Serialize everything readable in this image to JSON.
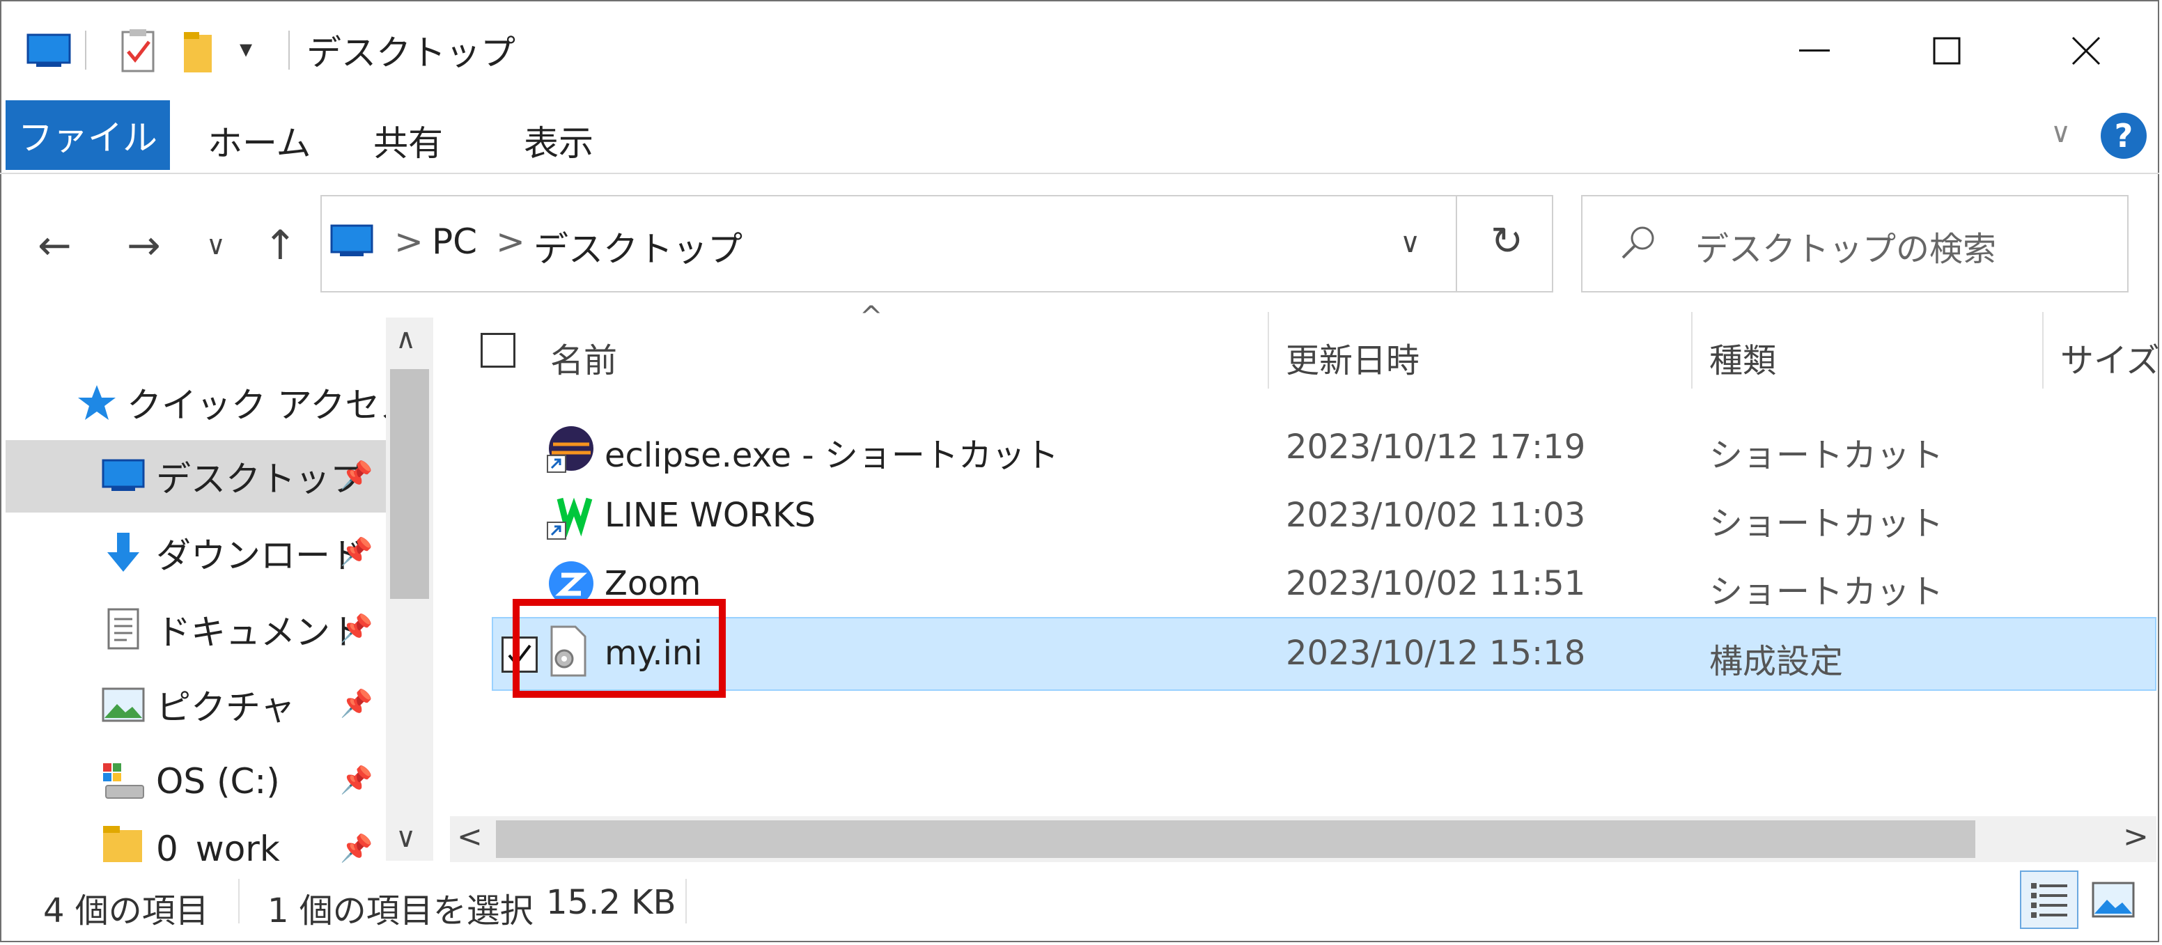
{
  "window": {
    "title": "デスクトップ",
    "minimize_glyph": "—",
    "maximize_glyph": "☐",
    "close_glyph": "✕"
  },
  "ribbon": {
    "tabs": [
      "ファイル",
      "ホーム",
      "共有",
      "表示"
    ],
    "expand_glyph": "∨",
    "help_glyph": "?"
  },
  "navigation": {
    "back_glyph": "←",
    "forward_glyph": "→",
    "recent_glyph": "∨",
    "up_glyph": "↑"
  },
  "address": {
    "breadcrumbs": [
      "PC",
      "デスクトップ"
    ],
    "separator": ">",
    "dropdown_glyph": "∨",
    "refresh_glyph": "↻"
  },
  "search": {
    "placeholder": "デスクトップの検索"
  },
  "nav_pane": {
    "quick_access": "クイック アクセス",
    "items": [
      {
        "label": "デスクトップ",
        "icon": "desktop-icon",
        "selected": true
      },
      {
        "label": "ダウンロード",
        "icon": "download-icon"
      },
      {
        "label": "ドキュメント",
        "icon": "document-icon"
      },
      {
        "label": "ピクチャ",
        "icon": "picture-icon"
      },
      {
        "label": "OS (C:)",
        "icon": "drive-icon"
      },
      {
        "label": "0_work",
        "icon": "folder-icon"
      }
    ]
  },
  "file_list": {
    "columns": [
      "名前",
      "更新日時",
      "種類",
      "サイズ"
    ],
    "sort_glyph": "^",
    "rows": [
      {
        "name": "eclipse.exe - ショートカット",
        "modified": "2023/10/12 17:19",
        "type": "ショートカット",
        "icon": "eclipse-icon"
      },
      {
        "name": "LINE WORKS",
        "modified": "2023/10/02 11:03",
        "type": "ショートカット",
        "icon": "lineworks-icon"
      },
      {
        "name": "Zoom",
        "modified": "2023/10/02 11:51",
        "type": "ショートカット",
        "icon": "zoom-icon"
      },
      {
        "name": "my.ini",
        "modified": "2023/10/12 15:18",
        "type": "構成設定",
        "icon": "config-file-icon",
        "selected": true
      }
    ]
  },
  "status_bar": {
    "item_count": "4 個の項目",
    "selection": "1 個の項目を選択",
    "size": "15.2 KB"
  },
  "colors": {
    "file_tab": "#1a6fc4",
    "selection_bg": "#cce8ff",
    "highlight_box": "#e00000"
  }
}
